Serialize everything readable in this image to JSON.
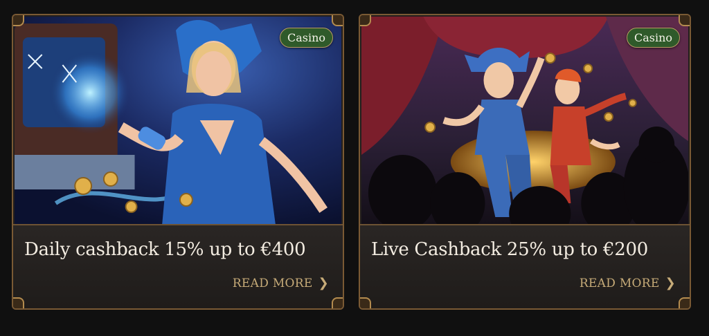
{
  "promos": [
    {
      "badge": "Casino",
      "title": "Daily cashback 15% up to €400",
      "read_more": "READ MORE",
      "image": "jester-woman-with-blue-magic-and-gold-coins"
    },
    {
      "badge": "Casino",
      "title": "Live Cashback 25% up to €200",
      "read_more": "READ MORE",
      "image": "jesters-on-stage-with-treasure-and-audience"
    }
  ],
  "colors": {
    "background": "#101010",
    "card": "#231f1d",
    "frame": "#7a5a34",
    "badge": "#2f5a2a",
    "read_more": "#c7ab78",
    "title": "#f3ece1"
  }
}
